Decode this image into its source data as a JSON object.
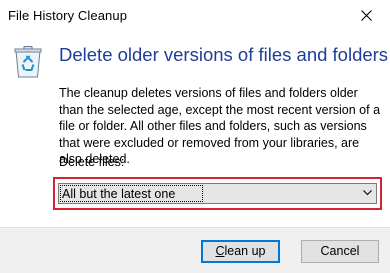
{
  "window": {
    "title": "File History Cleanup",
    "close_icon": "close-icon"
  },
  "content": {
    "icon": "recycle-bin-icon",
    "heading": "Delete older versions of files and folders",
    "description": "The cleanup deletes versions of files and folders older than the selected age, except the most recent version of a file or folder. All other files and folders, such as versions that were excluded or removed from your libraries, are also deleted.",
    "delete_files_label": "Delete files:",
    "delete_files_select": {
      "selected": "All but the latest one",
      "icon": "chevron-down-icon"
    },
    "highlight_color": "#d82131"
  },
  "footer": {
    "cleanup_button": {
      "accel": "C",
      "rest": "lean up"
    },
    "cancel_label": "Cancel"
  },
  "colors": {
    "heading": "#1f3d99",
    "default_button_border": "#0078d7"
  }
}
